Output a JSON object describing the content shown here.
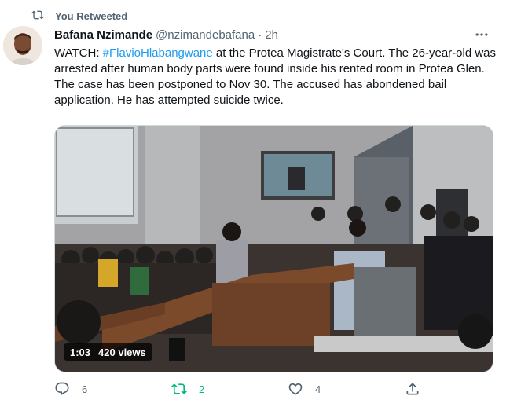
{
  "retweet_label": "You Retweeted",
  "author": {
    "name": "Bafana Nzimande",
    "handle": "@nzimandebafana",
    "separator": "·",
    "time": "2h"
  },
  "tweet": {
    "text_before": "WATCH: ",
    "hashtag": "#FlavioHlabangwane",
    "text_after": " at the Protea Magistrate's Court. The 26-year-old was arrested after human body parts were found inside his rented room in Protea Glen. The case has been postponed to Nov 30. The accused has abondened bail application. He has attempted suicide twice."
  },
  "video": {
    "duration": "1:03",
    "views": "420 views"
  },
  "actions": {
    "replies": "6",
    "retweets": "2",
    "likes": "4"
  },
  "colors": {
    "link": "#1d9bf0",
    "retweet_active": "#00ba7c",
    "muted": "#536471"
  },
  "icons": [
    "retweet-icon",
    "more-icon",
    "reply-icon",
    "like-icon",
    "share-icon"
  ]
}
